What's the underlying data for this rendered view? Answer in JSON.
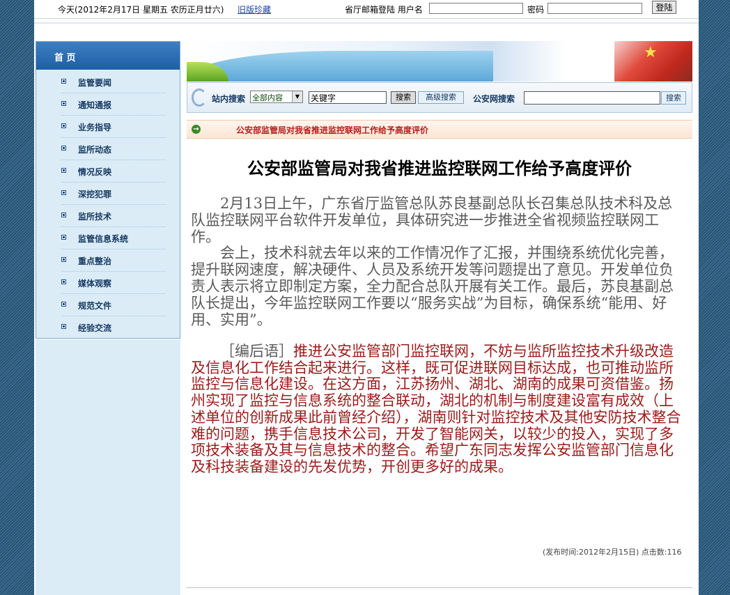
{
  "topbar": {
    "date_text": "今天(2012年2月17日  星期五  农历正月廿六)",
    "old_link": "旧版珍藏",
    "mail_label": "省厅邮箱登陆  用户名",
    "password_label": "密码",
    "login_button": "登陆"
  },
  "sidebar": {
    "home": "首  页",
    "items": [
      {
        "label": "监管要闻"
      },
      {
        "label": "通知通报"
      },
      {
        "label": "业务指导"
      },
      {
        "label": "监所动态"
      },
      {
        "label": "情况反映"
      },
      {
        "label": "深挖犯罪"
      },
      {
        "label": "监所技术"
      },
      {
        "label": "监管信息系统"
      },
      {
        "label": "重点整治"
      },
      {
        "label": "媒体观察"
      },
      {
        "label": "规范文件"
      },
      {
        "label": "经验交流"
      }
    ]
  },
  "search": {
    "site_label": "站内搜索",
    "scope_selected": "全部内容",
    "keyword_value": "关键字",
    "search_button": "搜索",
    "advanced_button": "高级搜索",
    "police_label": "公安网搜索",
    "police_button": "搜索"
  },
  "strip": {
    "headline": "公安部监管局对我省推进监控联网工作给予高度评价"
  },
  "article": {
    "title": "公安部监管局对我省推进监控联网工作给予高度评价",
    "paragraphs": [
      "2月13日上午，广东省厅监管总队苏良基副总队长召集总队技术科及总队监控联网平台软件开发单位，具体研究进一步推进全省视频监控联网工作。",
      "会上，技术科就去年以来的工作情况作了汇报，并围绕系统优化完善，提升联网速度，解决硬件、人员及系统开发等问题提出了意见。开发单位负责人表示将立即制定方案，全力配合总队开展有关工作。最后，苏良基副总队长提出，今年监控联网工作要以“服务实战”为目标，确保系统“能用、好用、实用”。"
    ],
    "editor_tag": "［编后语］",
    "editor_text": "推进公安监管部门监控联网，不妨与监所监控技术升级改造及信息化工作结合起来进行。这样，既可促进联网目标达成，也可推动监所监控与信息化建设。在这方面，江苏扬州、湖北、湖南的成果可资借鉴。扬州实现了监控与信息系统的整合联动，湖北的机制与制度建设富有成效（上述单位的创新成果此前曾经介绍），湖南则针对监控技术及其他安防技术整合难的问题，携手信息技术公司，开发了智能网关，以较少的投入，实现了多项技术装备及其与信息技术的整合。希望广东同志发挥公安监管部门信息化及科技装备建设的先发优势，开创更多好的成果。",
    "publish_info": "(发布时间:2012年2月15日)    点击数:116"
  },
  "colors": {
    "background_blue": "#2d5878",
    "sidebar_head": "#1e5fa6",
    "sidebar_bg": "#dbecf7",
    "headline_red": "#b81b1b",
    "editor_red": "#9c1a1a"
  }
}
